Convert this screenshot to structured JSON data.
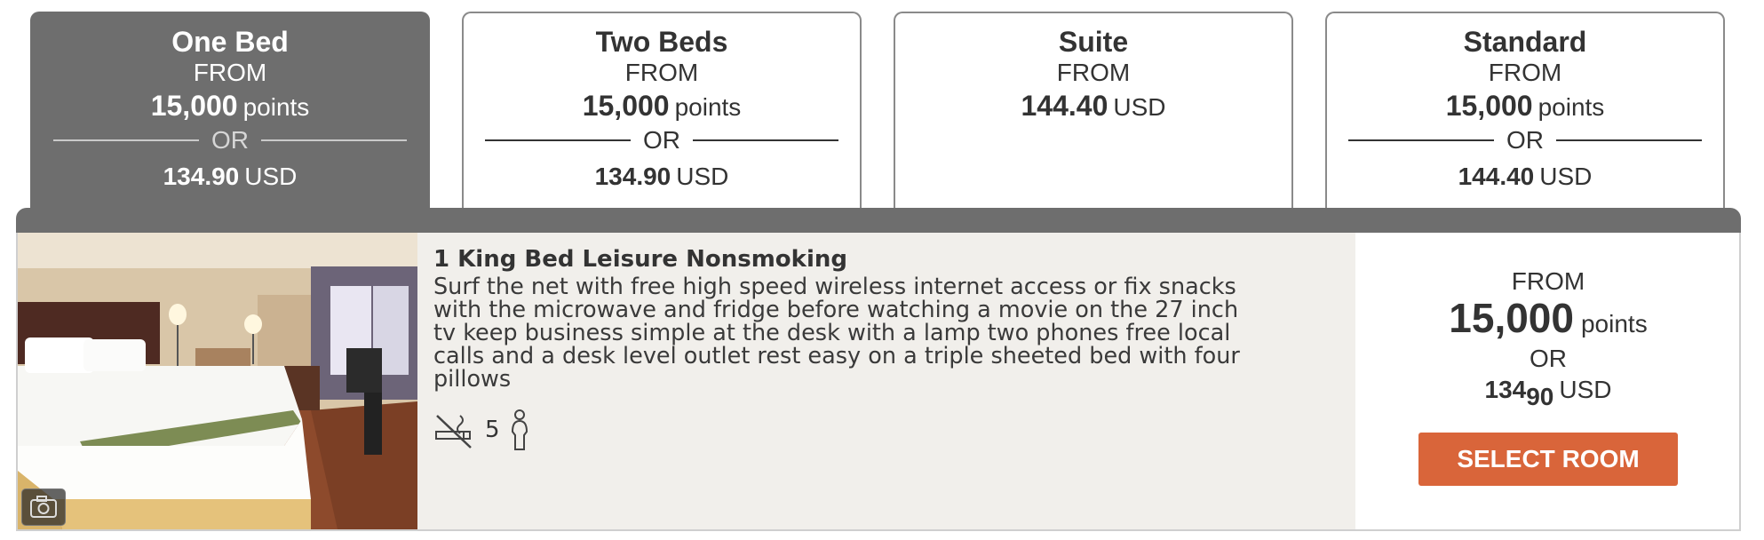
{
  "tabs": [
    {
      "name": "One Bed",
      "from": "FROM",
      "points": "15,000",
      "points_unit": "points",
      "or": "OR",
      "usd": "134.90",
      "currency": "USD",
      "active": true
    },
    {
      "name": "Two Beds",
      "from": "FROM",
      "points": "15,000",
      "points_unit": "points",
      "or": "OR",
      "usd": "134.90",
      "currency": "USD",
      "active": false
    },
    {
      "name": "Suite",
      "from": "FROM",
      "usd": "144.40",
      "currency": "USD",
      "active": false
    },
    {
      "name": "Standard",
      "from": "FROM",
      "points": "15,000",
      "points_unit": "points",
      "or": "OR",
      "usd": "144.40",
      "currency": "USD",
      "active": false
    }
  ],
  "room": {
    "title": "1 King Bed Leisure Nonsmoking",
    "description": "Surf the net with free high speed wireless internet access or fix snacks\nwith the microwave and fridge before watching a movie on the 27 inch\ntv keep business simple at the desk with a lamp two phones free local\ncalls and a desk level outlet rest easy on a triple sheeted bed with four\npillows",
    "max_guests": "5",
    "icons": {
      "photo": "camera-icon",
      "smoking": "no-smoking-icon",
      "guests": "person-icon"
    },
    "price": {
      "from": "FROM",
      "points": "15,000",
      "points_unit": "points",
      "or": "OR",
      "usd_dollars": "134",
      "usd_cents": "90",
      "currency": "USD"
    },
    "select_label": "SELECT ROOM"
  },
  "colors": {
    "active_tab": "#6e6e6e",
    "accent": "#d9653a",
    "info_bg": "#f1efeb"
  }
}
